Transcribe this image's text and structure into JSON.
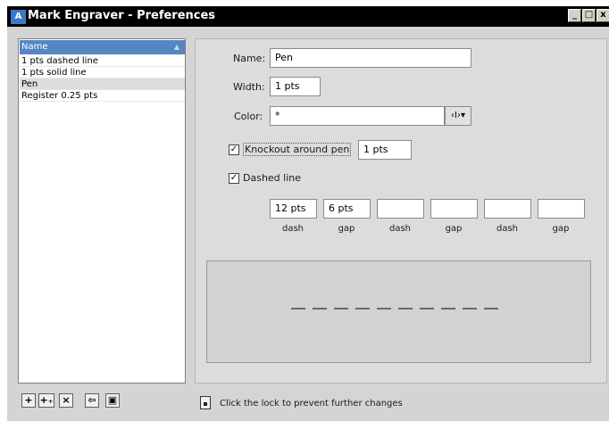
{
  "window": {
    "app_icon": "A",
    "title": "Mark Engraver - Preferences",
    "controls": {
      "minimize": "_",
      "maximize": "□",
      "close": "x"
    }
  },
  "list": {
    "header": "Name",
    "items": [
      {
        "label": "1 pts dashed line",
        "selected": false
      },
      {
        "label": "1 pts solid line",
        "selected": false
      },
      {
        "label": "Pen",
        "selected": true
      },
      {
        "label": "Register 0.25 pts",
        "selected": false
      }
    ]
  },
  "toolbar": {
    "add_label": "+",
    "add_copy_label": "+₊",
    "delete_label": "×",
    "import_label": "⇦",
    "save_label": "▣"
  },
  "form": {
    "name_label": "Name:",
    "name_value": "Pen",
    "width_label": "Width:",
    "width_value": "1 pts",
    "color_label": "Color:",
    "color_value": "*",
    "color_picker_label": "‹I›",
    "knockout_checked": true,
    "knockout_label": "Knockout around pen",
    "knockout_value": "1 pts",
    "dashed_checked": true,
    "dashed_label": "Dashed line",
    "dash_pattern": [
      {
        "value": "12 pts",
        "label": "dash"
      },
      {
        "value": "6 pts",
        "label": "gap"
      },
      {
        "value": "",
        "label": "dash"
      },
      {
        "value": "",
        "label": "gap"
      },
      {
        "value": "",
        "label": "dash"
      },
      {
        "value": "",
        "label": "gap"
      }
    ]
  },
  "preview": {
    "stroke_color": "#000000",
    "dash_count": 10
  },
  "footer": {
    "lock_text": "Click the lock to prevent further changes"
  },
  "colors": {
    "title_bar": "#000000",
    "list_header": "#5586c4",
    "selected_row": "#dcdcdc",
    "panel_bg": "#dcdcdc"
  }
}
